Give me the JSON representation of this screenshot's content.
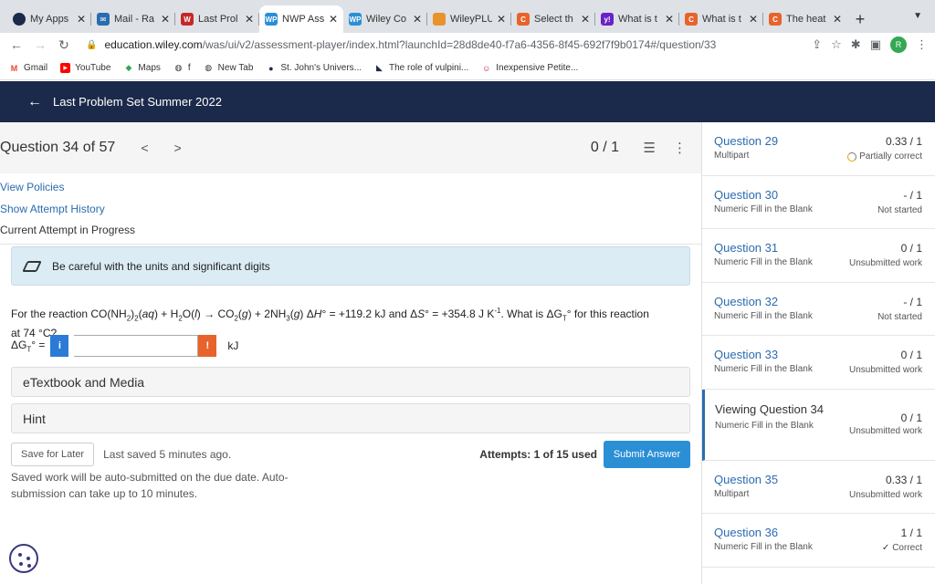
{
  "browser": {
    "tabs": [
      {
        "label": "My Apps",
        "icon": "circle-icon",
        "color": "#1b2a4a"
      },
      {
        "label": "Mail - Ra",
        "icon": "mail-icon",
        "color": "#2b6cb0"
      },
      {
        "label": "Last Prol",
        "icon": "wiley-icon",
        "color": "#c62828"
      },
      {
        "label": "NWP Ass",
        "icon": "wp-icon",
        "color": "#2b8fd6",
        "active": true
      },
      {
        "label": "Wiley Co",
        "icon": "wp-icon",
        "color": "#2b8fd6"
      },
      {
        "label": "WileyPLU",
        "icon": "bag-icon",
        "color": "#e8932b"
      },
      {
        "label": "Select th",
        "icon": "chegg-icon",
        "color": "#e8632b"
      },
      {
        "label": "What is t",
        "icon": "yahoo-icon",
        "color": "#6b21c8"
      },
      {
        "label": "What is t",
        "icon": "chegg-icon",
        "color": "#e8632b"
      },
      {
        "label": "The heat",
        "icon": "chegg-icon",
        "color": "#e8632b"
      }
    ],
    "url_host": "education.wiley.com",
    "url_path": "/was/ui/v2/assessment-player/index.html?launchId=28d8de40-f7a6-4356-8f45-692f7f9b0174#/question/33",
    "profile_initial": "R",
    "bookmarks": [
      {
        "label": "Gmail",
        "icon": "gmail-icon"
      },
      {
        "label": "YouTube",
        "icon": "youtube-icon"
      },
      {
        "label": "Maps",
        "icon": "maps-icon"
      },
      {
        "label": "f",
        "icon": "globe-icon"
      },
      {
        "label": "New Tab",
        "icon": "globe-icon"
      },
      {
        "label": "St. John's Univers...",
        "icon": "circle-icon"
      },
      {
        "label": "The role of vulpini...",
        "icon": "triangle-icon"
      },
      {
        "label": "Inexpensive Petite...",
        "icon": "smile-icon"
      }
    ]
  },
  "header": {
    "back_label": "Last Problem Set Summer 2022"
  },
  "question": {
    "title": "Question 34 of 57",
    "score": "0 / 1",
    "links": {
      "policies": "View Policies",
      "history": "Show Attempt History"
    },
    "attempt_status": "Current Attempt in Progress",
    "tip": "Be careful with the units and significant digits",
    "text_line2": "at 74 °C?",
    "answer_label": "ΔG",
    "answer_value": "",
    "unit": "kJ",
    "accordions": [
      "eTextbook and Media",
      "Hint"
    ],
    "save_label": "Save for Later",
    "last_saved": "Last saved 5 minutes ago.",
    "attempts": "Attempts: 1 of 15 used",
    "submit_label": "Submit Answer",
    "autosubmit_note": "Saved work will be auto-submitted on the due date. Auto-submission can take up to 10 minutes."
  },
  "sidebar": {
    "items": [
      {
        "title": "Question 29",
        "type": "Multipart",
        "score": "0.33 / 1",
        "status": "Partially correct",
        "status_icon": "partial-icon"
      },
      {
        "title": "Question 30",
        "type": "Numeric Fill in the Blank",
        "score": "- / 1",
        "status": "Not started"
      },
      {
        "title": "Question 31",
        "type": "Numeric Fill in the Blank",
        "score": "0 / 1",
        "status": "Unsubmitted work"
      },
      {
        "title": "Question 32",
        "type": "Numeric Fill in the Blank",
        "score": "- / 1",
        "status": "Not started"
      },
      {
        "title": "Question 33",
        "type": "Numeric Fill in the Blank",
        "score": "0 / 1",
        "status": "Unsubmitted work"
      },
      {
        "title": "Viewing Question 34",
        "type": "Numeric Fill in the Blank",
        "score": "0 / 1",
        "status": "Unsubmitted work",
        "current": true
      },
      {
        "title": "Question 35",
        "type": "Multipart",
        "score": "0.33 / 1",
        "status": "Unsubmitted work"
      },
      {
        "title": "Question 36",
        "type": "Numeric Fill in the Blank",
        "score": "1 / 1",
        "status": "Correct",
        "status_icon": "check-icon"
      }
    ]
  }
}
